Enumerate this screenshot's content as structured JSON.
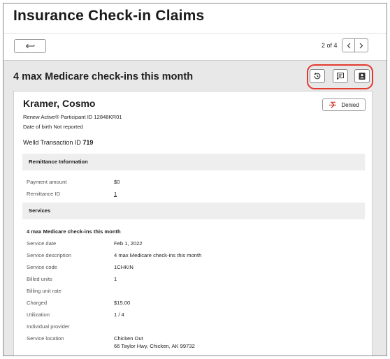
{
  "page": {
    "title": "Insurance Check-in Claims"
  },
  "pager": {
    "text": "2 of 4"
  },
  "section": {
    "heading": "4 max Medicare check-ins this month"
  },
  "header_actions": [
    "history-icon",
    "message-icon",
    "contact-card-icon"
  ],
  "accent": {
    "highlight": "#e33b2f",
    "denied": "#d9453a"
  },
  "participant": {
    "name": "Kramer, Cosmo",
    "id_line": "Renew Active® Participant ID 12848KR01",
    "dob_line": "Date of birth Not reported",
    "status": "Denied"
  },
  "transaction": {
    "label": "Welld Transaction ID",
    "value": "719"
  },
  "remittance": {
    "heading": "Remittance Information",
    "payment_amount_label": "Payment amount",
    "payment_amount_value": "$0",
    "remittance_id_label": "Remittance ID",
    "remittance_id_value": "1"
  },
  "services": {
    "heading": "Services",
    "subheading": "4 max Medicare check-ins this month",
    "rows": [
      {
        "label": "Service date",
        "value": "Feb 1, 2022"
      },
      {
        "label": "Service description",
        "value": "4 max Medicare check-ins this month"
      },
      {
        "label": "Service code",
        "value": "1CHKIN"
      },
      {
        "label": "Billed units",
        "value": "1"
      },
      {
        "label": "Billing unit rate",
        "value": ""
      },
      {
        "label": "Charged",
        "value": "$15.00"
      },
      {
        "label": "Utilization",
        "value": "1 / 4"
      },
      {
        "label": "Individual provider",
        "value": ""
      },
      {
        "label": "Service location",
        "value": "Chicken Out",
        "value2": "66 Taylor Hwy, Chicken, AK 99732"
      }
    ]
  }
}
